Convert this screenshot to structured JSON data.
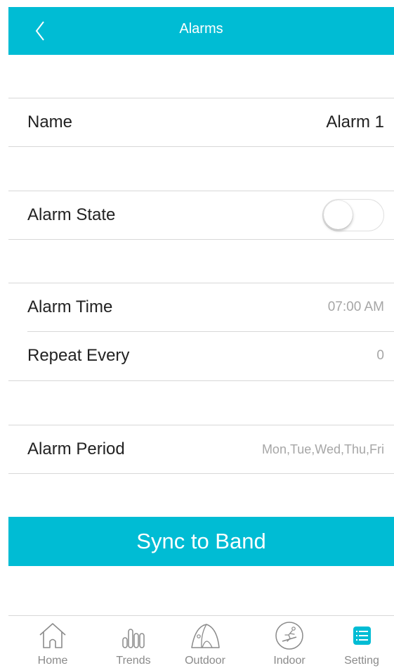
{
  "header": {
    "title": "Alarms",
    "back_icon": "chevron-left-icon",
    "background": "#00bcd4"
  },
  "settings": {
    "name": {
      "label": "Name",
      "value": "Alarm 1"
    },
    "alarm_state": {
      "label": "Alarm State",
      "enabled": false
    },
    "alarm_time": {
      "label": "Alarm Time",
      "value": "07:00 AM"
    },
    "repeat_every": {
      "label": "Repeat Every",
      "value": "0"
    },
    "alarm_period": {
      "label": "Alarm Period",
      "value": "Mon,Tue,Wed,Thu,Fri"
    }
  },
  "actions": {
    "sync_label": "Sync to Band"
  },
  "tabbar": {
    "active": "Setting",
    "active_color": "#00bcd4",
    "inactive_color": "#8a8a8a",
    "items": [
      {
        "label": "Home",
        "icon": "home-icon"
      },
      {
        "label": "Trends",
        "icon": "bar-chart-icon"
      },
      {
        "label": "Outdoor",
        "icon": "tent-icon"
      },
      {
        "label": "Indoor",
        "icon": "treadmill-icon"
      },
      {
        "label": "Setting",
        "icon": "settings-list-icon"
      }
    ]
  }
}
